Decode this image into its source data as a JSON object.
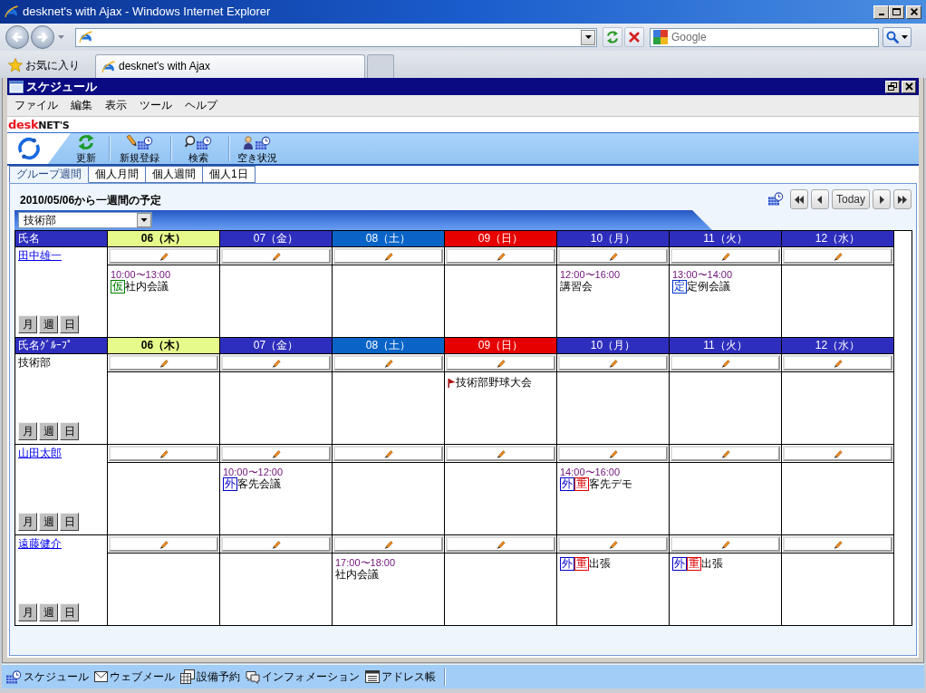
{
  "browser": {
    "title": "desknet's with Ajax - Windows Internet Explorer",
    "search": {
      "placeholder": "Google"
    },
    "favorites": "お気に入り",
    "tabs": [
      {
        "label": "desknet's with Ajax",
        "selected": true
      }
    ]
  },
  "app": {
    "title": "スケジュール",
    "menu": [
      "ファイル",
      "編集",
      "表示",
      "ツール",
      "ヘルプ"
    ],
    "logo": [
      "desk",
      "NET'S"
    ],
    "toolbar": [
      {
        "kind": "refresh",
        "label": "更新"
      },
      {
        "kind": "new",
        "label": "新規登録"
      },
      {
        "kind": "search",
        "label": "検索"
      },
      {
        "kind": "availability",
        "label": "空き状況"
      }
    ],
    "tabs": [
      {
        "label": "グループ週間",
        "selected": true
      },
      {
        "label": "個人月間",
        "selected": false
      },
      {
        "label": "個人週間",
        "selected": false
      },
      {
        "label": "個人1日",
        "selected": false
      }
    ],
    "heading": "2010/05/06から一週間の予定",
    "navigation": {
      "today": "Today"
    },
    "group_select": {
      "value": "技術部"
    },
    "sections": [
      {
        "header": {
          "label": "氏名",
          "days": [
            {
              "label": "06（木）",
              "kind": "today"
            },
            {
              "label": "07（金）",
              "kind": "weekday"
            },
            {
              "label": "08（土）",
              "kind": "saturday"
            },
            {
              "label": "09（日）",
              "kind": "sunday"
            },
            {
              "label": "10（月）",
              "kind": "weekday"
            },
            {
              "label": "11（火）",
              "kind": "weekday"
            },
            {
              "label": "12（水）",
              "kind": "weekday"
            }
          ]
        },
        "rows": [
          {
            "kind": "user",
            "name": "田中雄一",
            "view_buttons": [
              "月",
              "週",
              "日"
            ],
            "cells": [
              {
                "events": [
                  {
                    "kind": "schedule",
                    "time": "10:00〜13:00",
                    "badges": [
                      {
                        "label": "仮",
                        "color": "#008000"
                      }
                    ],
                    "title": "社内会議"
                  }
                ]
              },
              {},
              {},
              {},
              {
                "events": [
                  {
                    "kind": "schedule",
                    "time": "12:00〜16:00",
                    "title": "講習会"
                  }
                ]
              },
              {
                "events": [
                  {
                    "kind": "schedule",
                    "time": "13:00〜14:00",
                    "badges": [
                      {
                        "label": "定",
                        "color": "#0033cc"
                      }
                    ],
                    "title": "定例会議"
                  }
                ]
              },
              {}
            ]
          }
        ]
      },
      {
        "header": {
          "label": "氏名ｸﾞﾙｰﾌﾟ",
          "days": [
            {
              "label": "06（木）",
              "kind": "today"
            },
            {
              "label": "07（金）",
              "kind": "weekday"
            },
            {
              "label": "08（土）",
              "kind": "saturday"
            },
            {
              "label": "09（日）",
              "kind": "sunday"
            },
            {
              "label": "10（月）",
              "kind": "weekday"
            },
            {
              "label": "11（火）",
              "kind": "weekday"
            },
            {
              "label": "12（水）",
              "kind": "weekday"
            }
          ]
        },
        "rows": [
          {
            "kind": "group",
            "name": "技術部",
            "view_buttons": [
              "月",
              "週",
              "日"
            ],
            "cells": [
              {},
              {},
              {},
              {
                "events": [
                  {
                    "kind": "group_event",
                    "title": "技術部野球大会"
                  }
                ]
              },
              {},
              {},
              {}
            ]
          },
          {
            "kind": "user",
            "name": "山田太郎",
            "view_buttons": [
              "月",
              "週",
              "日"
            ],
            "cells": [
              {},
              {
                "events": [
                  {
                    "kind": "schedule",
                    "time": "10:00〜12:00",
                    "badges": [
                      {
                        "label": "外",
                        "color": "#0000cc"
                      }
                    ],
                    "title": "客先会議"
                  }
                ]
              },
              {},
              {},
              {
                "events": [
                  {
                    "kind": "schedule",
                    "time": "14:00〜16:00",
                    "badges": [
                      {
                        "label": "外",
                        "color": "#0000cc"
                      },
                      {
                        "label": "重",
                        "color": "#dd0000"
                      }
                    ],
                    "title": "客先デモ"
                  }
                ]
              },
              {},
              {}
            ]
          },
          {
            "kind": "user",
            "name": "遠藤健介",
            "view_buttons": [
              "月",
              "週",
              "日"
            ],
            "cells": [
              {},
              {},
              {
                "events": [
                  {
                    "kind": "schedule",
                    "time": "17:00〜18:00",
                    "title": "社内会議"
                  }
                ]
              },
              {},
              {
                "events": [
                  {
                    "kind": "schedule",
                    "badges": [
                      {
                        "label": "外",
                        "color": "#0000cc"
                      },
                      {
                        "label": "重",
                        "color": "#dd0000"
                      }
                    ],
                    "title": "出張"
                  }
                ]
              },
              {
                "events": [
                  {
                    "kind": "schedule",
                    "badges": [
                      {
                        "label": "外",
                        "color": "#0000cc"
                      },
                      {
                        "label": "重",
                        "color": "#dd0000"
                      }
                    ],
                    "title": "出張"
                  }
                ]
              },
              {}
            ]
          }
        ]
      }
    ],
    "taskbar": [
      {
        "kind": "schedule",
        "label": "スケジュール"
      },
      {
        "kind": "mail",
        "label": "ウェブメール"
      },
      {
        "kind": "facility",
        "label": "設備予約"
      },
      {
        "kind": "information",
        "label": "インフォメーション"
      },
      {
        "kind": "address_book",
        "label": "アドレス帳"
      }
    ]
  }
}
